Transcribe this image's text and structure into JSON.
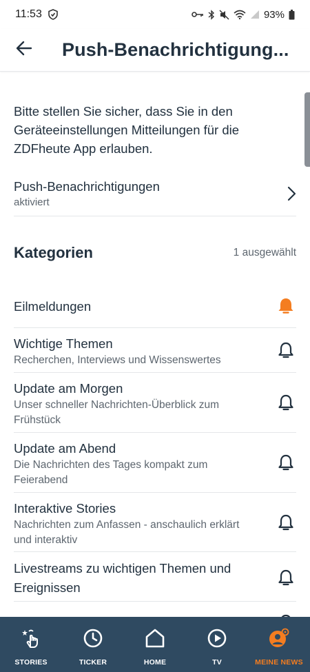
{
  "status_bar": {
    "time": "11:53",
    "battery": "93%"
  },
  "header": {
    "title": "Push-Benachrichtigung..."
  },
  "info": {
    "text": "Bitte stellen Sie sicher, dass Sie in den Geräteeinstellungen Mitteilungen für die ZDFheute App erlauben."
  },
  "push": {
    "title": "Push-Benachrichtigungen",
    "status": "aktiviert"
  },
  "categories": {
    "title": "Kategorien",
    "count": "1 ausgewählt",
    "items": [
      {
        "name": "Eilmeldungen",
        "desc": "",
        "active": true
      },
      {
        "name": "Wichtige Themen",
        "desc": "Recherchen, Interviews und Wissenswertes",
        "active": false
      },
      {
        "name": "Update am Morgen",
        "desc": "Unser schneller Nachrichten-Überblick zum Frühstück",
        "active": false
      },
      {
        "name": "Update am Abend",
        "desc": "Die Nachrichten des Tages kompakt zum Feierabend",
        "active": false
      },
      {
        "name": "Interaktive Stories",
        "desc": "Nachrichten zum Anfassen - anschaulich erklärt und interaktiv",
        "active": false
      },
      {
        "name": "Livestreams zu wichtigen Themen und Ereignissen",
        "desc": "",
        "active": false
      }
    ]
  },
  "nav": {
    "items": [
      {
        "label": "STORIES",
        "icon": "stories-hand-icon"
      },
      {
        "label": "TICKER",
        "icon": "clock-icon"
      },
      {
        "label": "HOME",
        "icon": "home-icon"
      },
      {
        "label": "TV",
        "icon": "play-icon"
      },
      {
        "label": "MEINE NEWS",
        "icon": "user-gear-icon",
        "active": true
      }
    ]
  },
  "colors": {
    "accent": "#f47d20",
    "nav_bg": "#2f4a61",
    "text": "#22313f"
  }
}
